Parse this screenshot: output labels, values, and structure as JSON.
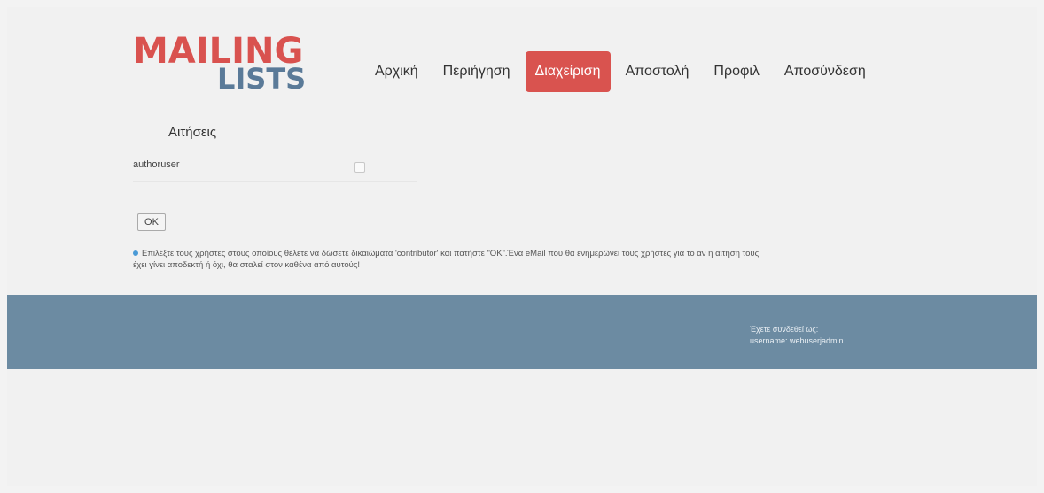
{
  "logo": {
    "line1": "MAILING",
    "line2": "LISTS"
  },
  "nav": {
    "items": [
      {
        "label": "Αρχική"
      },
      {
        "label": "Περιήγηση"
      },
      {
        "label": "Διαχείριση",
        "active": true
      },
      {
        "label": "Αποστολή"
      },
      {
        "label": "Προφιλ"
      },
      {
        "label": "Αποσύνδεση"
      }
    ]
  },
  "requests": {
    "title": "Αιτήσεις",
    "rows": [
      {
        "user": "authoruser",
        "checked": false
      }
    ]
  },
  "ok_button": "OK",
  "info": {
    "line1": "Επιλέξτε τους χρήστες στους οποίους θέλετε να δώσετε δικαιώματα 'contributor' και πατήστε \"OK\".Ένα eMail που θα ενημερώνει τους χρήστες για το αν η αίτηση τους",
    "line2": "έχει γίνει αποδεκτή ή όχι, θα σταλεί στον καθένα από αυτούς!"
  },
  "footer": {
    "login_label": "Έχετε συνδεθεί ως:",
    "login_value": "username: webuserjadmin"
  },
  "colors": {
    "brand_red": "#d9524f",
    "brand_blue": "#5a7a98",
    "footer": "#6c8ba2",
    "active_nav": "#d9534f"
  }
}
